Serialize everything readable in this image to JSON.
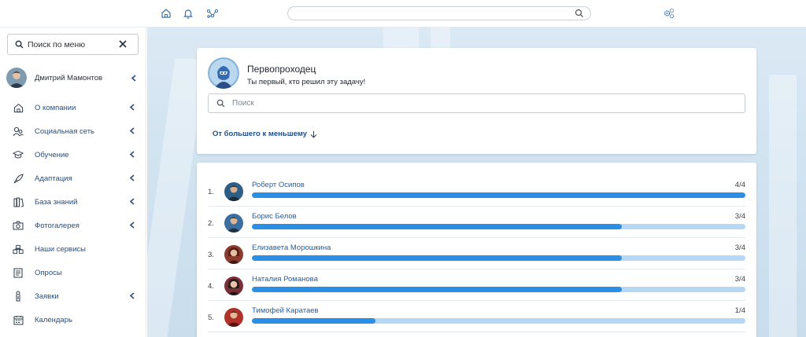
{
  "topbar": {
    "icons": [
      "home-icon",
      "bell-icon",
      "network-icon",
      "search-icon",
      "settings-cluster-icon"
    ],
    "search_value": ""
  },
  "sidebar": {
    "search_label": "Поиск по меню",
    "user_name": "Дмитрий Мамонтов",
    "items": [
      {
        "label": "О компании",
        "icon": "home-icon",
        "expandable": true
      },
      {
        "label": "Социальная сеть",
        "icon": "people-icon",
        "expandable": true
      },
      {
        "label": "Обучение",
        "icon": "graduation-cap-icon",
        "expandable": true
      },
      {
        "label": "Адаптация",
        "icon": "rocket-icon",
        "expandable": true
      },
      {
        "label": "База знаний",
        "icon": "books-icon",
        "expandable": true
      },
      {
        "label": "Фотогалерея",
        "icon": "camera-icon",
        "expandable": true
      },
      {
        "label": "Наши сервисы",
        "icon": "services-icon",
        "expandable": false
      },
      {
        "label": "Опросы",
        "icon": "survey-icon",
        "expandable": false
      },
      {
        "label": "Заявки",
        "icon": "request-icon",
        "expandable": true
      },
      {
        "label": "Календарь",
        "icon": "calendar-icon",
        "expandable": false
      }
    ]
  },
  "achievement": {
    "title": "Первопроходец",
    "description": "Ты первый, кто решил эту задачу!",
    "search_placeholder": "Поиск",
    "sort_label": "От большего к меньшему"
  },
  "leaderboard": [
    {
      "rank": "1.",
      "name": "Роберт Осипов",
      "score": "4/4",
      "progress": 1.0,
      "avatar_color": "#2d5f86"
    },
    {
      "rank": "2.",
      "name": "Борис Белов",
      "score": "3/4",
      "progress": 0.75,
      "avatar_color": "#3a6fa0"
    },
    {
      "rank": "3.",
      "name": "Елизавета Морошкина",
      "score": "3/4",
      "progress": 0.75,
      "avatar_color": "#8a3b2e"
    },
    {
      "rank": "4.",
      "name": "Наталия Романова",
      "score": "3/4",
      "progress": 0.75,
      "avatar_color": "#7a2e36"
    },
    {
      "rank": "5.",
      "name": "Тимофей Каратаев",
      "score": "1/4",
      "progress": 0.25,
      "avatar_color": "#b0302a"
    }
  ],
  "colors": {
    "accent": "#2b8fe5",
    "track": "#b7d8f5",
    "link": "#1f4f86"
  }
}
